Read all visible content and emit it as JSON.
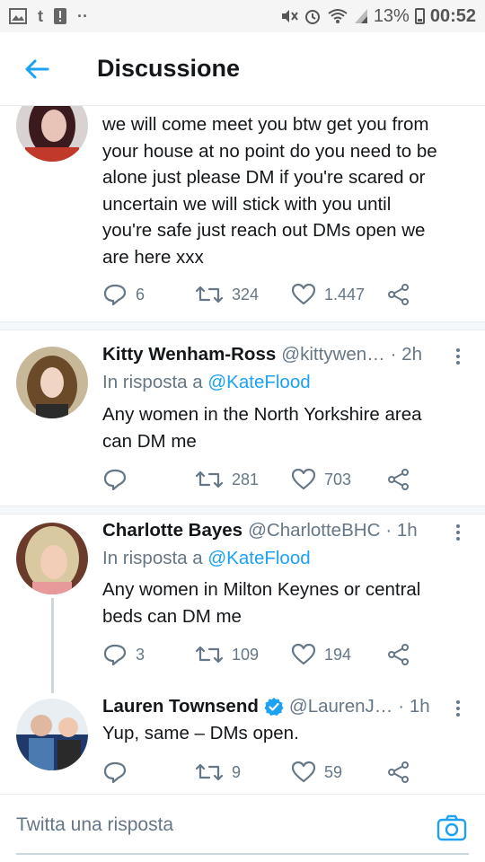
{
  "status_bar": {
    "left_icons": [
      "image-icon",
      "tumblr-icon",
      "alert-icon",
      "more-dots-icon"
    ],
    "t_glyph": "t",
    "battery": "13%",
    "time": "00:52"
  },
  "header": {
    "title": "Discussione"
  },
  "tweets": [
    {
      "text_lines": [
        "we will come meet you btw get you from",
        "your house at no point do you need to be",
        "alone just please DM if you're scared or",
        "uncertain we will stick with you until",
        "you're safe just reach out DMs open we",
        "are here xxx"
      ],
      "replies": "6",
      "retweets": "324",
      "likes": "1.447"
    },
    {
      "name": "Kitty Wenham-Ross",
      "handle": "@kittywen…",
      "time": "· 2h",
      "reply_prefix": "In risposta a",
      "reply_to": "@KateFlood",
      "text_lines": [
        "Any women in the North Yorkshire area",
        "can DM me"
      ],
      "replies": "",
      "retweets": "281",
      "likes": "703"
    },
    {
      "name": "Charlotte Bayes",
      "handle": "@CharlotteBHC",
      "time": "· 1h",
      "reply_prefix": "In risposta a",
      "reply_to": "@KateFlood",
      "text_lines": [
        "Any women in Milton Keynes or central",
        "beds can DM me"
      ],
      "replies": "3",
      "retweets": "109",
      "likes": "194"
    },
    {
      "name": "Lauren Townsend",
      "handle": "@LaurenJ…",
      "time": "· 1h",
      "verified": true,
      "text_lines": [
        "Yup, same – DMs open."
      ],
      "replies": "",
      "retweets": "9",
      "likes": "59"
    }
  ],
  "compose": {
    "placeholder": "Twitta una risposta"
  },
  "colors": {
    "accent": "#1da1f2",
    "text": "#14171a",
    "secondary": "#657786",
    "divider": "#f5f8fa"
  }
}
